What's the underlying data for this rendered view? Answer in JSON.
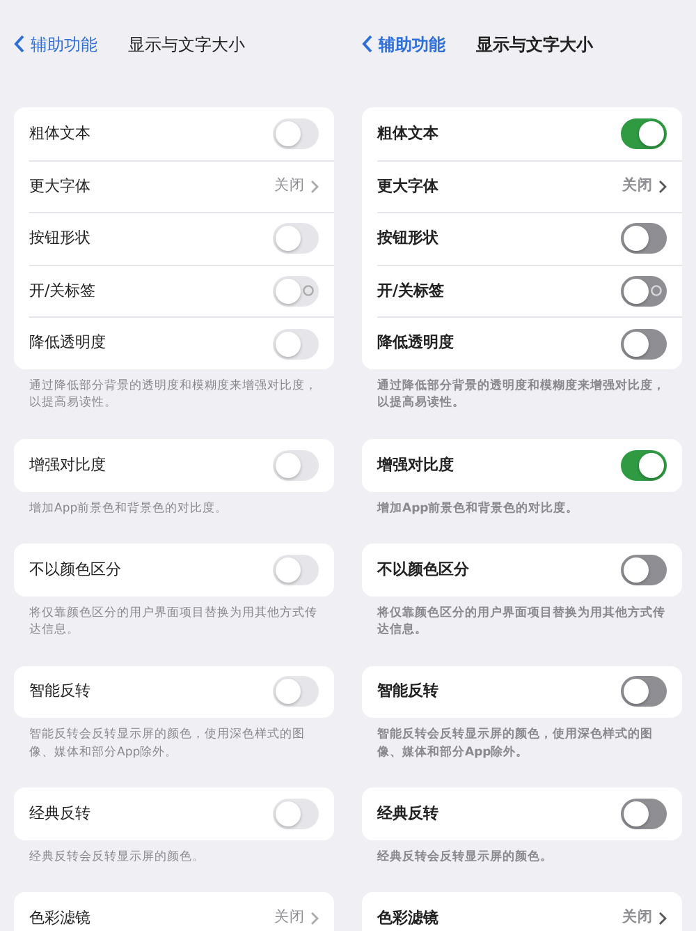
{
  "panels": [
    {
      "nav": {
        "back": "辅助功能",
        "title": "显示与文字大小"
      },
      "groups": [
        {
          "rows": [
            {
              "kind": "toggle",
              "label": "粗体文本",
              "on": false
            },
            {
              "kind": "link",
              "label": "更大字体",
              "value": "关闭"
            },
            {
              "kind": "toggle",
              "label": "按钮形状",
              "on": false
            },
            {
              "kind": "toggle",
              "label": "开/关标签",
              "on": false,
              "labels": true
            },
            {
              "kind": "toggle",
              "label": "降低透明度",
              "on": false
            }
          ],
          "footer": "通过降低部分背景的透明度和模糊度来增强对比度，以提高易读性。"
        },
        {
          "rows": [
            {
              "kind": "toggle",
              "label": "增强对比度",
              "on": false
            }
          ],
          "footer": "增加App前景色和背景色的对比度。"
        },
        {
          "rows": [
            {
              "kind": "toggle",
              "label": "不以颜色区分",
              "on": false
            }
          ],
          "footer": "将仅靠颜色区分的用户界面项目替换为用其他方式传达信息。"
        },
        {
          "rows": [
            {
              "kind": "toggle",
              "label": "智能反转",
              "on": false
            }
          ],
          "footer": "智能反转会反转显示屏的颜色，使用深色样式的图像、媒体和部分App除外。"
        },
        {
          "rows": [
            {
              "kind": "toggle",
              "label": "经典反转",
              "on": false
            }
          ],
          "footer": "经典反转会反转显示屏的颜色。"
        },
        {
          "rows": [
            {
              "kind": "link",
              "label": "色彩滤镜",
              "value": "关闭"
            }
          ]
        }
      ]
    },
    {
      "nav": {
        "back": "辅助功能",
        "title": "显示与文字大小"
      },
      "groups": [
        {
          "rows": [
            {
              "kind": "toggle",
              "label": "粗体文本",
              "on": true
            },
            {
              "kind": "link",
              "label": "更大字体",
              "value": "关闭"
            },
            {
              "kind": "toggle",
              "label": "按钮形状",
              "on": false
            },
            {
              "kind": "toggle",
              "label": "开/关标签",
              "on": false,
              "labels": true
            },
            {
              "kind": "toggle",
              "label": "降低透明度",
              "on": false
            }
          ],
          "footer": "通过降低部分背景的透明度和模糊度来增强对比度，以提高易读性。"
        },
        {
          "rows": [
            {
              "kind": "toggle",
              "label": "增强对比度",
              "on": true
            }
          ],
          "footer": "增加App前景色和背景色的对比度。"
        },
        {
          "rows": [
            {
              "kind": "toggle",
              "label": "不以颜色区分",
              "on": false
            }
          ],
          "footer": "将仅靠颜色区分的用户界面项目替换为用其他方式传达信息。"
        },
        {
          "rows": [
            {
              "kind": "toggle",
              "label": "智能反转",
              "on": false
            }
          ],
          "footer": "智能反转会反转显示屏的颜色，使用深色样式的图像、媒体和部分App除外。"
        },
        {
          "rows": [
            {
              "kind": "toggle",
              "label": "经典反转",
              "on": false
            }
          ],
          "footer": "经典反转会反转显示屏的颜色。"
        },
        {
          "rows": [
            {
              "kind": "link",
              "label": "色彩滤镜",
              "value": "关闭"
            }
          ]
        }
      ]
    }
  ]
}
